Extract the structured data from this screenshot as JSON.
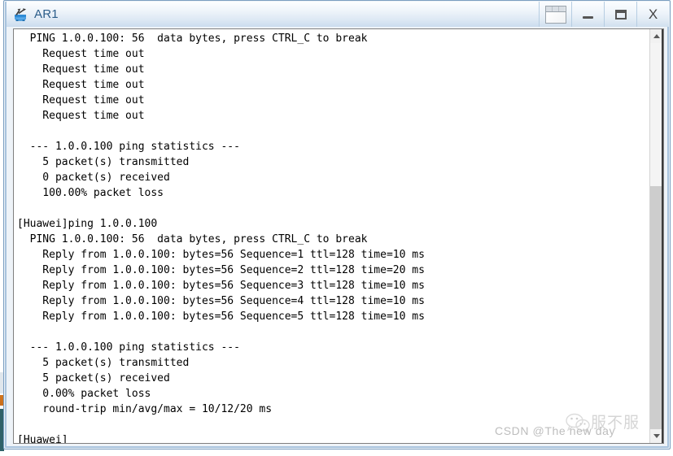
{
  "window": {
    "title": "AR1",
    "app_icon": "router-icon",
    "buttons": [
      {
        "name": "window-list-button",
        "icon": "window-list-icon",
        "label": ""
      },
      {
        "name": "minimize-button",
        "icon": "minimize-icon",
        "label": ""
      },
      {
        "name": "maximize-button",
        "icon": "maximize-icon",
        "label": ""
      },
      {
        "name": "close-button",
        "icon": "close-icon",
        "label": "X"
      }
    ]
  },
  "terminal": {
    "lines": [
      "  PING 1.0.0.100: 56  data bytes, press CTRL_C to break",
      "    Request time out",
      "    Request time out",
      "    Request time out",
      "    Request time out",
      "    Request time out",
      "",
      "  --- 1.0.0.100 ping statistics ---",
      "    5 packet(s) transmitted",
      "    0 packet(s) received",
      "    100.00% packet loss",
      "",
      "[Huawei]ping 1.0.0.100",
      "  PING 1.0.0.100: 56  data bytes, press CTRL_C to break",
      "    Reply from 1.0.0.100: bytes=56 Sequence=1 ttl=128 time=10 ms",
      "    Reply from 1.0.0.100: bytes=56 Sequence=2 ttl=128 time=20 ms",
      "    Reply from 1.0.0.100: bytes=56 Sequence=3 ttl=128 time=10 ms",
      "    Reply from 1.0.0.100: bytes=56 Sequence=4 ttl=128 time=10 ms",
      "    Reply from 1.0.0.100: bytes=56 Sequence=5 ttl=128 time=10 ms",
      "",
      "  --- 1.0.0.100 ping statistics ---",
      "    5 packet(s) transmitted",
      "    5 packet(s) received",
      "    0.00% packet loss",
      "    round-trip min/avg/max = 10/12/20 ms",
      "",
      "[Huawei]"
    ]
  },
  "scrollbar": {
    "up_arrow": "scroll-up-icon",
    "down_arrow": "scroll-down-icon"
  },
  "watermark": {
    "text": "CSDN @The  new  day",
    "cn_text": "服不服",
    "logo": "wechat-icon"
  },
  "colors": {
    "title_text": "#2b5d8a",
    "window_border": "#7a9ec0",
    "terminal_bg": "#ffffff",
    "terminal_text": "#000000",
    "scrollbar_thumb": "#cdcdcd",
    "watermark": "#bdbdbd"
  }
}
